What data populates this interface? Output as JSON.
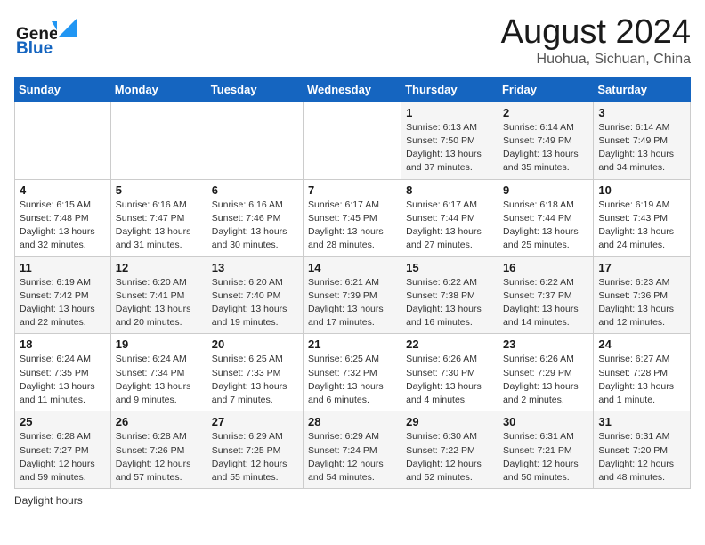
{
  "header": {
    "logo_general": "General",
    "logo_blue": "Blue",
    "title": "August 2024",
    "subtitle": "Huohua, Sichuan, China"
  },
  "calendar": {
    "days_of_week": [
      "Sunday",
      "Monday",
      "Tuesday",
      "Wednesday",
      "Thursday",
      "Friday",
      "Saturday"
    ],
    "weeks": [
      [
        {
          "day": "",
          "sunrise": "",
          "sunset": "",
          "daylight": ""
        },
        {
          "day": "",
          "sunrise": "",
          "sunset": "",
          "daylight": ""
        },
        {
          "day": "",
          "sunrise": "",
          "sunset": "",
          "daylight": ""
        },
        {
          "day": "",
          "sunrise": "",
          "sunset": "",
          "daylight": ""
        },
        {
          "day": "1",
          "sunrise": "Sunrise: 6:13 AM",
          "sunset": "Sunset: 7:50 PM",
          "daylight": "Daylight: 13 hours and 37 minutes."
        },
        {
          "day": "2",
          "sunrise": "Sunrise: 6:14 AM",
          "sunset": "Sunset: 7:49 PM",
          "daylight": "Daylight: 13 hours and 35 minutes."
        },
        {
          "day": "3",
          "sunrise": "Sunrise: 6:14 AM",
          "sunset": "Sunset: 7:49 PM",
          "daylight": "Daylight: 13 hours and 34 minutes."
        }
      ],
      [
        {
          "day": "4",
          "sunrise": "Sunrise: 6:15 AM",
          "sunset": "Sunset: 7:48 PM",
          "daylight": "Daylight: 13 hours and 32 minutes."
        },
        {
          "day": "5",
          "sunrise": "Sunrise: 6:16 AM",
          "sunset": "Sunset: 7:47 PM",
          "daylight": "Daylight: 13 hours and 31 minutes."
        },
        {
          "day": "6",
          "sunrise": "Sunrise: 6:16 AM",
          "sunset": "Sunset: 7:46 PM",
          "daylight": "Daylight: 13 hours and 30 minutes."
        },
        {
          "day": "7",
          "sunrise": "Sunrise: 6:17 AM",
          "sunset": "Sunset: 7:45 PM",
          "daylight": "Daylight: 13 hours and 28 minutes."
        },
        {
          "day": "8",
          "sunrise": "Sunrise: 6:17 AM",
          "sunset": "Sunset: 7:44 PM",
          "daylight": "Daylight: 13 hours and 27 minutes."
        },
        {
          "day": "9",
          "sunrise": "Sunrise: 6:18 AM",
          "sunset": "Sunset: 7:44 PM",
          "daylight": "Daylight: 13 hours and 25 minutes."
        },
        {
          "day": "10",
          "sunrise": "Sunrise: 6:19 AM",
          "sunset": "Sunset: 7:43 PM",
          "daylight": "Daylight: 13 hours and 24 minutes."
        }
      ],
      [
        {
          "day": "11",
          "sunrise": "Sunrise: 6:19 AM",
          "sunset": "Sunset: 7:42 PM",
          "daylight": "Daylight: 13 hours and 22 minutes."
        },
        {
          "day": "12",
          "sunrise": "Sunrise: 6:20 AM",
          "sunset": "Sunset: 7:41 PM",
          "daylight": "Daylight: 13 hours and 20 minutes."
        },
        {
          "day": "13",
          "sunrise": "Sunrise: 6:20 AM",
          "sunset": "Sunset: 7:40 PM",
          "daylight": "Daylight: 13 hours and 19 minutes."
        },
        {
          "day": "14",
          "sunrise": "Sunrise: 6:21 AM",
          "sunset": "Sunset: 7:39 PM",
          "daylight": "Daylight: 13 hours and 17 minutes."
        },
        {
          "day": "15",
          "sunrise": "Sunrise: 6:22 AM",
          "sunset": "Sunset: 7:38 PM",
          "daylight": "Daylight: 13 hours and 16 minutes."
        },
        {
          "day": "16",
          "sunrise": "Sunrise: 6:22 AM",
          "sunset": "Sunset: 7:37 PM",
          "daylight": "Daylight: 13 hours and 14 minutes."
        },
        {
          "day": "17",
          "sunrise": "Sunrise: 6:23 AM",
          "sunset": "Sunset: 7:36 PM",
          "daylight": "Daylight: 13 hours and 12 minutes."
        }
      ],
      [
        {
          "day": "18",
          "sunrise": "Sunrise: 6:24 AM",
          "sunset": "Sunset: 7:35 PM",
          "daylight": "Daylight: 13 hours and 11 minutes."
        },
        {
          "day": "19",
          "sunrise": "Sunrise: 6:24 AM",
          "sunset": "Sunset: 7:34 PM",
          "daylight": "Daylight: 13 hours and 9 minutes."
        },
        {
          "day": "20",
          "sunrise": "Sunrise: 6:25 AM",
          "sunset": "Sunset: 7:33 PM",
          "daylight": "Daylight: 13 hours and 7 minutes."
        },
        {
          "day": "21",
          "sunrise": "Sunrise: 6:25 AM",
          "sunset": "Sunset: 7:32 PM",
          "daylight": "Daylight: 13 hours and 6 minutes."
        },
        {
          "day": "22",
          "sunrise": "Sunrise: 6:26 AM",
          "sunset": "Sunset: 7:30 PM",
          "daylight": "Daylight: 13 hours and 4 minutes."
        },
        {
          "day": "23",
          "sunrise": "Sunrise: 6:26 AM",
          "sunset": "Sunset: 7:29 PM",
          "daylight": "Daylight: 13 hours and 2 minutes."
        },
        {
          "day": "24",
          "sunrise": "Sunrise: 6:27 AM",
          "sunset": "Sunset: 7:28 PM",
          "daylight": "Daylight: 13 hours and 1 minute."
        }
      ],
      [
        {
          "day": "25",
          "sunrise": "Sunrise: 6:28 AM",
          "sunset": "Sunset: 7:27 PM",
          "daylight": "Daylight: 12 hours and 59 minutes."
        },
        {
          "day": "26",
          "sunrise": "Sunrise: 6:28 AM",
          "sunset": "Sunset: 7:26 PM",
          "daylight": "Daylight: 12 hours and 57 minutes."
        },
        {
          "day": "27",
          "sunrise": "Sunrise: 6:29 AM",
          "sunset": "Sunset: 7:25 PM",
          "daylight": "Daylight: 12 hours and 55 minutes."
        },
        {
          "day": "28",
          "sunrise": "Sunrise: 6:29 AM",
          "sunset": "Sunset: 7:24 PM",
          "daylight": "Daylight: 12 hours and 54 minutes."
        },
        {
          "day": "29",
          "sunrise": "Sunrise: 6:30 AM",
          "sunset": "Sunset: 7:22 PM",
          "daylight": "Daylight: 12 hours and 52 minutes."
        },
        {
          "day": "30",
          "sunrise": "Sunrise: 6:31 AM",
          "sunset": "Sunset: 7:21 PM",
          "daylight": "Daylight: 12 hours and 50 minutes."
        },
        {
          "day": "31",
          "sunrise": "Sunrise: 6:31 AM",
          "sunset": "Sunset: 7:20 PM",
          "daylight": "Daylight: 12 hours and 48 minutes."
        }
      ]
    ]
  },
  "footer": {
    "text": "Daylight hours"
  }
}
